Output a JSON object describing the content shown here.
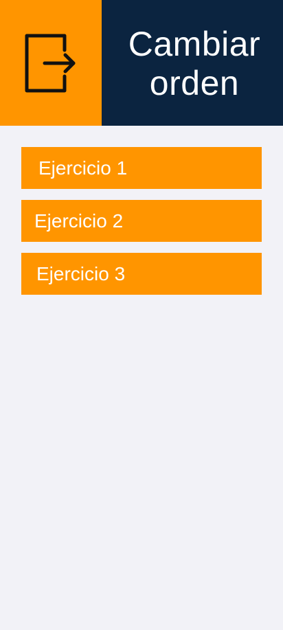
{
  "header": {
    "exit_icon": "exit-door-arrow-icon",
    "title": "Cambiar\norden"
  },
  "exercises": [
    {
      "label": "Ejercicio 1"
    },
    {
      "label": "Ejercicio 2"
    },
    {
      "label": "Ejercicio 3"
    }
  ],
  "colors": {
    "accent": "#ff9500",
    "header_bg": "#0b2440",
    "page_bg": "#f2f2f7",
    "text_light": "#ffffff"
  }
}
